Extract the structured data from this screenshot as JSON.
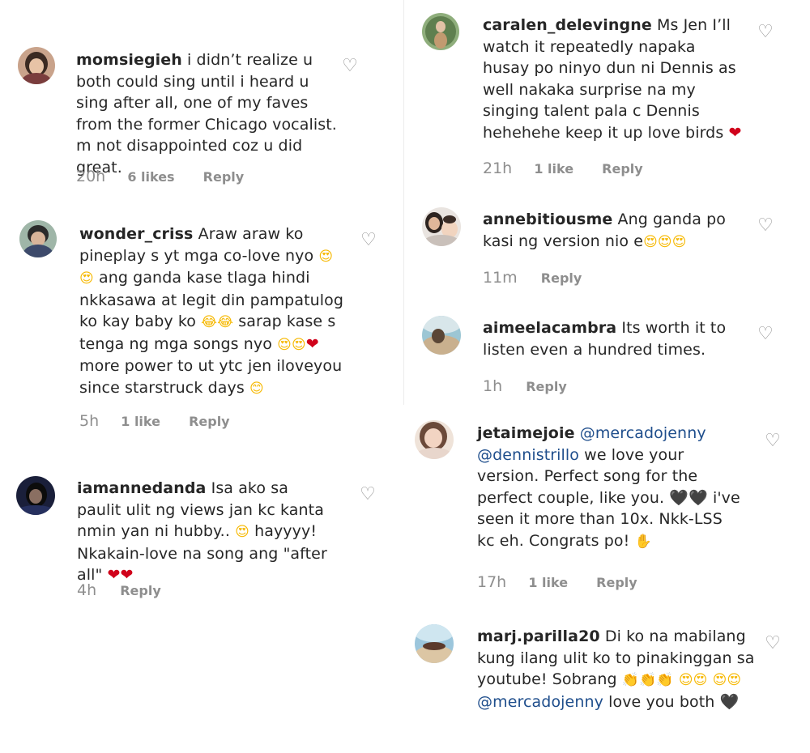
{
  "comments": [
    {
      "username": "momsiegieh",
      "text_html": "i didn’t realize u both could sing until i heard u sing after all, one of my faves from the former Chicago vocalist. m not disappointed coz u did great.",
      "time": "20h",
      "likes": "6 likes",
      "reply": "Reply"
    },
    {
      "username": "wonder_criss",
      "text": "Araw araw ko pineplay s yt mga co-love nyo 😍😍 ang ganda kase tlaga hindi nkkasawa at legit din pampatulog ko kay baby ko 😂😂 sarap kase s tenga ng mga songs nyo 😍😍❤️ more power to ut ytc jen iloveyou since starstruck days 😊",
      "time": "5h",
      "likes": "1 like",
      "reply": "Reply"
    },
    {
      "username": "iamannedanda",
      "text": "Isa ako sa paulit ulit ng views jan kc kanta nmin yan ni hubby.. 😍 hayyyy! Nkakain-love na song ang \"after all\" ❤️❤️",
      "time": "4h",
      "reply": "Reply"
    },
    {
      "username": "caralen_delevingne",
      "text": "Ms Jen I’ll watch it repeatedly napaka husay po ninyo dun ni Dennis as well nakaka surprise na my singing talent pala c Dennis hehehehe keep it up love birds ❤️",
      "time": "21h",
      "likes": "1 like",
      "reply": "Reply"
    },
    {
      "username": "annebitiousme",
      "text": "Ang ganda po kasi ng version nio e😍😍😍",
      "time": "11m",
      "reply": "Reply"
    },
    {
      "username": "aimeelacambra",
      "text": "Its worth it to listen even a hundred times.",
      "time": "1h",
      "reply": "Reply"
    },
    {
      "username": "jetaimejoie",
      "text": "@mercadojenny @dennistrillo we love your version. Perfect song for the perfect couple, like you. 🖤🖤 i've seen it more than 10x. Nkk-LSS kc eh. Congrats po! 👋",
      "time": "17h",
      "likes": "1 like",
      "reply": "Reply"
    },
    {
      "username": "marj.parilla20",
      "text": "Di ko na mabilang kung ilang ulit ko to pinakinggan sa youtube! Sobrang 👏👏👏 😍😍😍😍 @mercadojenny love you both 🖤",
      "reply": ""
    }
  ],
  "icons": {
    "heart": "heart-outline-icon",
    "heart_color": "#999999"
  },
  "colors": {
    "text": "#262626",
    "meta": "#8e8e8e",
    "mention": "#1f4e8c",
    "red_heart": "#d0021b"
  }
}
